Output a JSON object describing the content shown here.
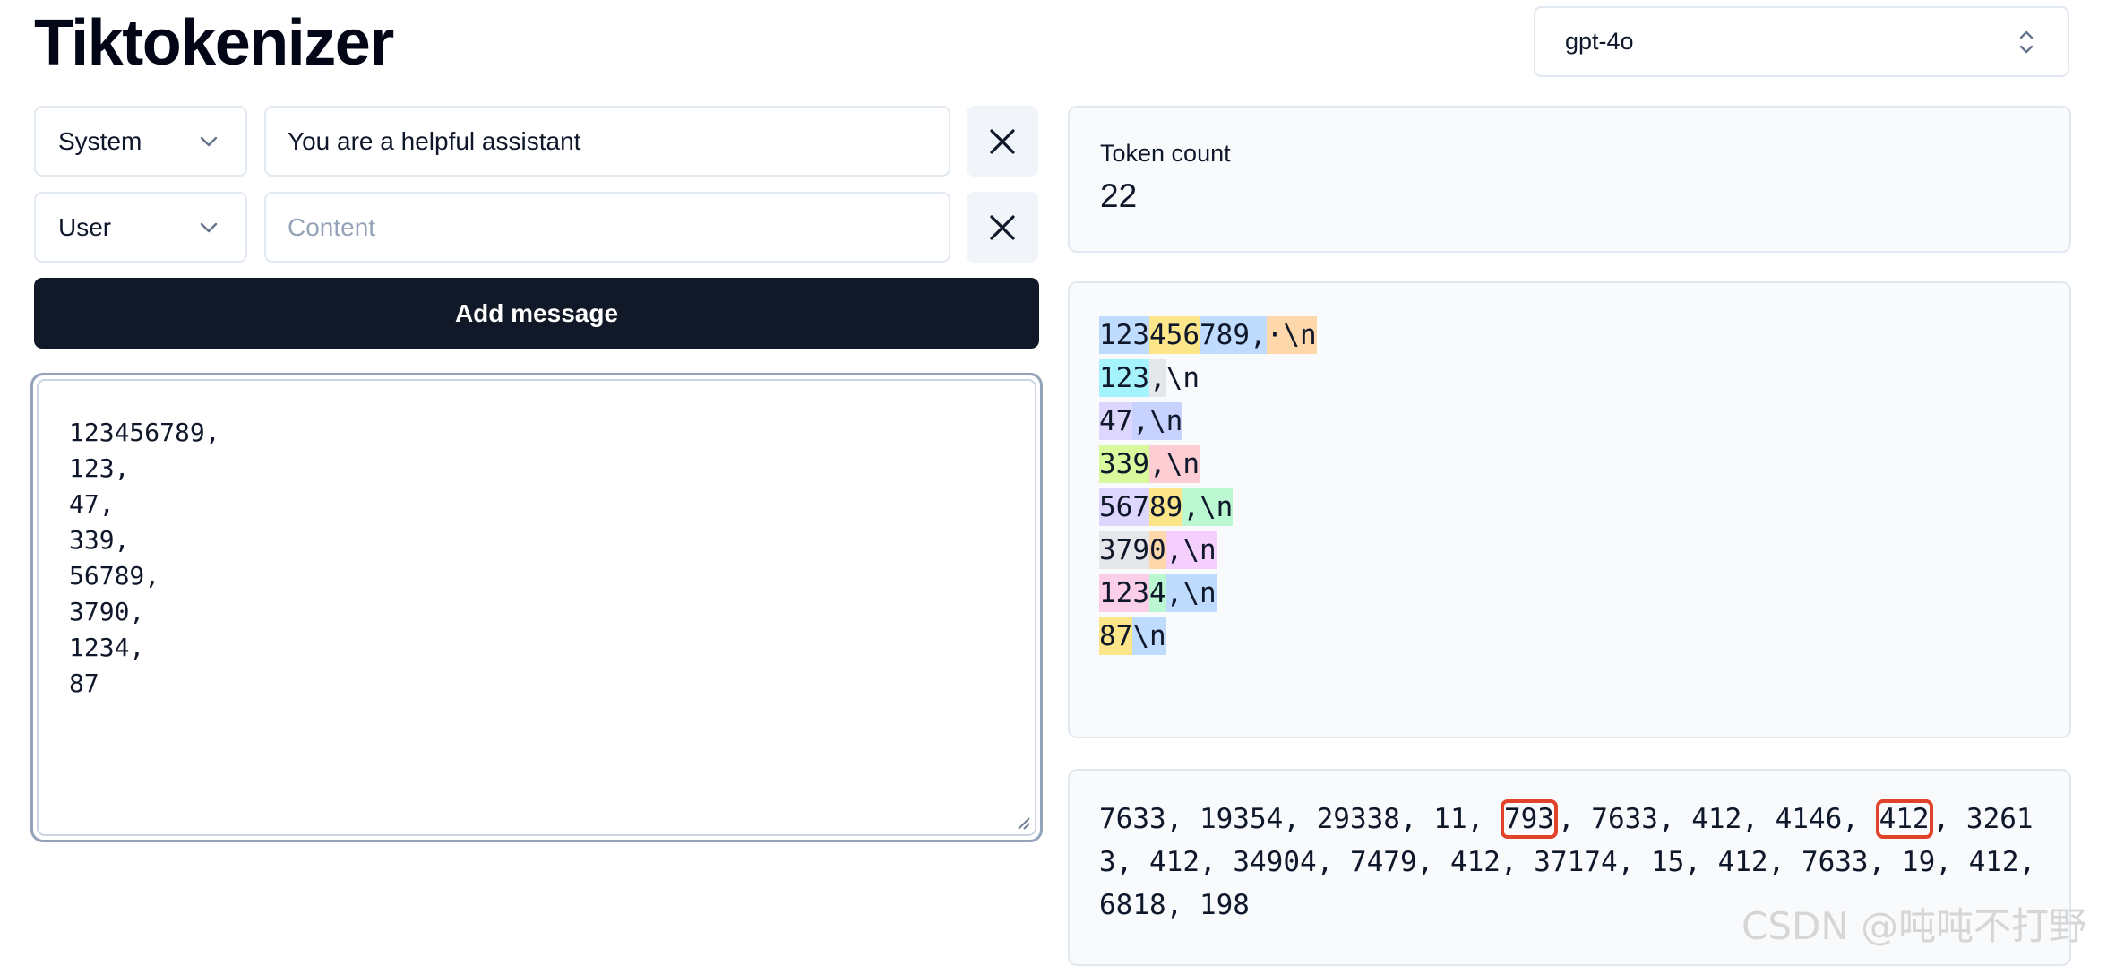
{
  "app": {
    "title": "Tiktokenizer"
  },
  "model_select": {
    "value": "gpt-4o"
  },
  "messages": [
    {
      "role": "System",
      "content": "You are a helpful assistant",
      "placeholder": "Content"
    },
    {
      "role": "User",
      "content": "",
      "placeholder": "Content"
    }
  ],
  "add_message_label": "Add message",
  "input_text": "123456789,\n123,\n47,\n339,\n56789,\n3790,\n1234,\n87",
  "token_count": {
    "label": "Token count",
    "value": "22"
  },
  "token_colors": {
    "blue": "#bfdbfe",
    "yellow": "#fde68a",
    "orange": "#fed7aa",
    "cyan": "#a5f3fc",
    "gray": "#e5e7eb",
    "purple": "#ddd6fe",
    "lime": "#d9f99d",
    "pink": "#fecdd3",
    "green": "#bbf7d0",
    "fuchsia": "#f5d0fe",
    "rose": "#fbcfe8",
    "indigo": "#c7d2fe",
    "highlight": "#e0422a"
  },
  "token_lines": [
    [
      {
        "text": "123",
        "color": "blue"
      },
      {
        "text": "456",
        "color": "yellow"
      },
      {
        "text": "789",
        "color": "blue"
      },
      {
        "text": ",",
        "color": "blue"
      },
      {
        "text": "·\\n",
        "color": "orange"
      }
    ],
    [
      {
        "text": "123",
        "color": "cyan"
      },
      {
        "text": ",",
        "color": "gray"
      },
      {
        "text": "\\n",
        "color": "none"
      }
    ],
    [
      {
        "text": "47",
        "color": "purple"
      },
      {
        "text": ",\\n",
        "color": "indigo"
      }
    ],
    [
      {
        "text": "339",
        "color": "lime"
      },
      {
        "text": ",\\n",
        "color": "pink"
      }
    ],
    [
      {
        "text": "567",
        "color": "purple"
      },
      {
        "text": "89",
        "color": "yellow"
      },
      {
        "text": ",\\n",
        "color": "green"
      }
    ],
    [
      {
        "text": "379",
        "color": "gray"
      },
      {
        "text": "0",
        "color": "orange"
      },
      {
        "text": ",\\n",
        "color": "fuchsia"
      }
    ],
    [
      {
        "text": "123",
        "color": "rose"
      },
      {
        "text": "4",
        "color": "green"
      },
      {
        "text": ",\\n",
        "color": "blue"
      }
    ],
    [
      {
        "text": "87",
        "color": "yellow"
      },
      {
        "text": "\\n",
        "color": "blue"
      }
    ]
  ],
  "token_ids": [
    7633,
    19354,
    29338,
    11,
    793,
    7633,
    412,
    4146,
    412,
    32613,
    412,
    34904,
    7479,
    412,
    37174,
    15,
    412,
    7633,
    19,
    412,
    6818,
    198
  ],
  "highlighted_token_indices": [
    4,
    8
  ],
  "watermark": "CSDN @吨吨不打野"
}
